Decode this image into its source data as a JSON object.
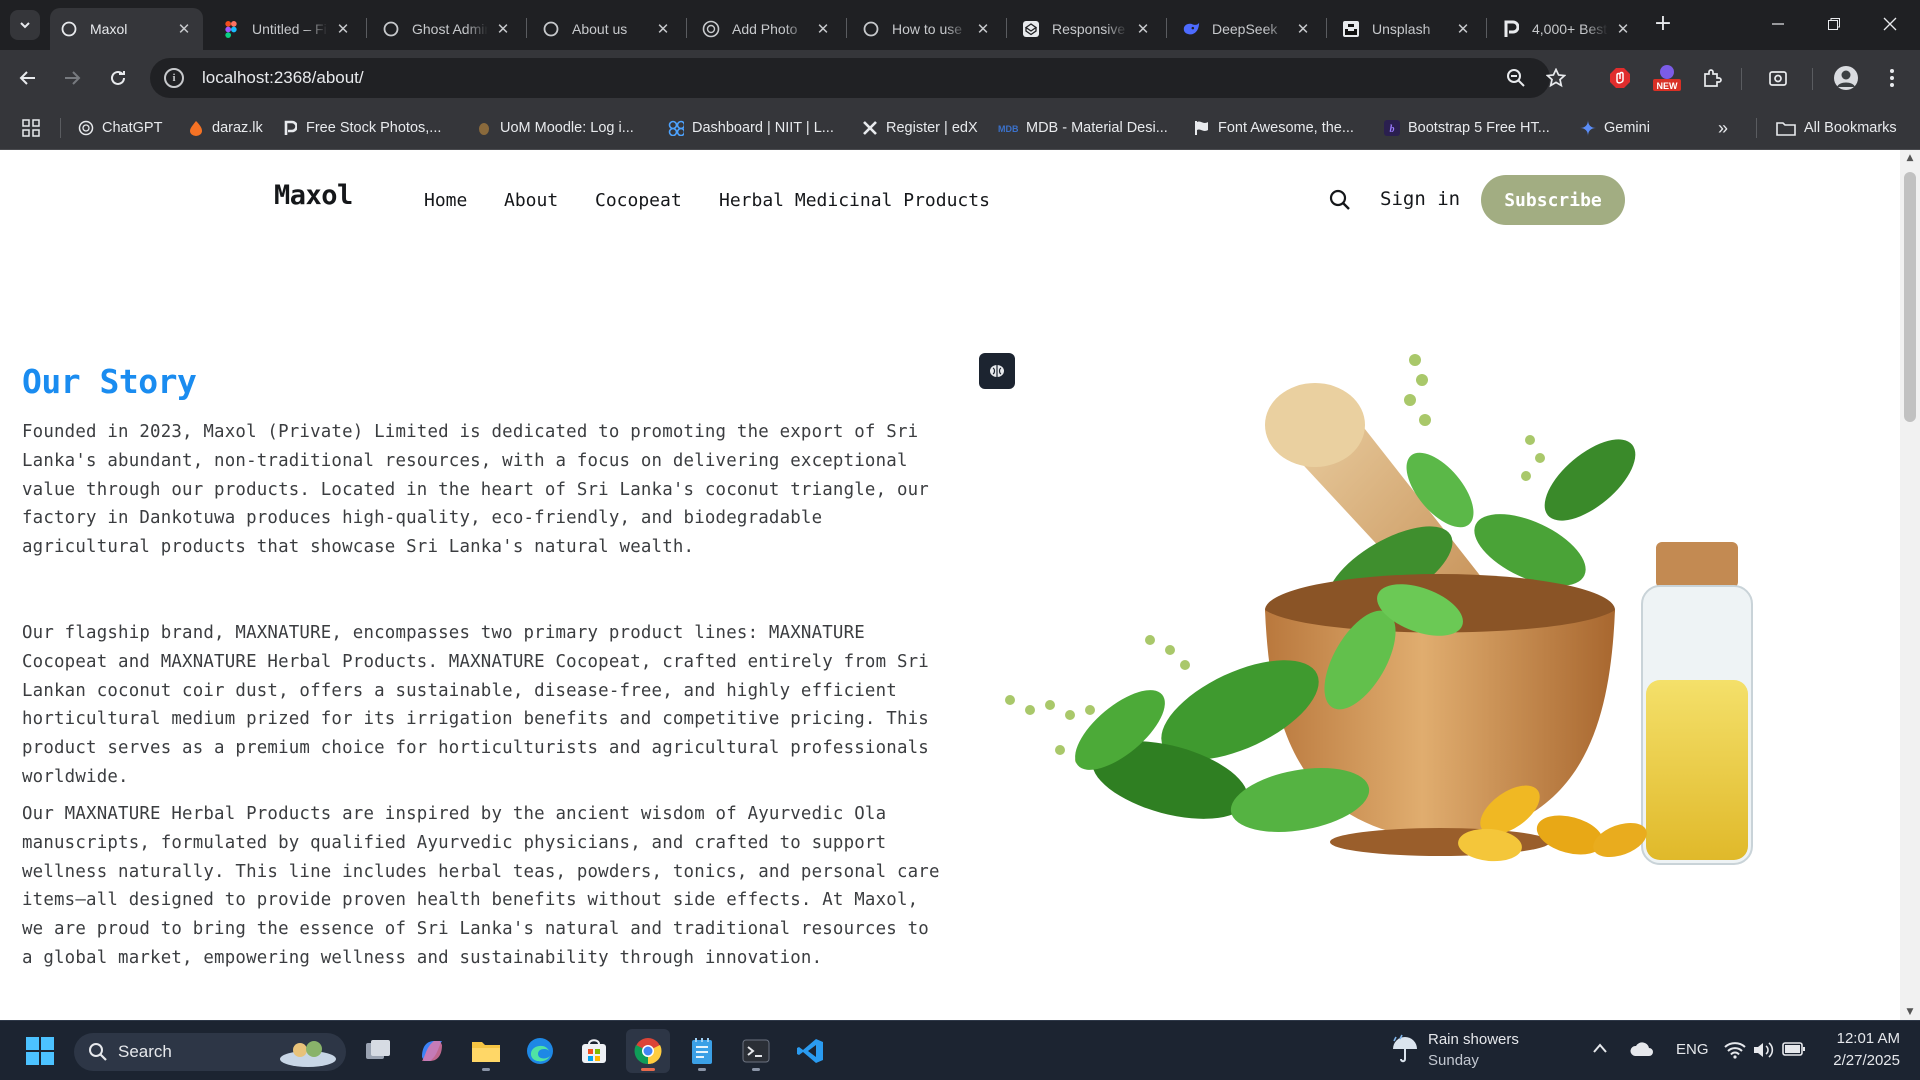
{
  "browser": {
    "tabs": [
      {
        "title": "Maxol",
        "icon": "globe-icon",
        "active": true
      },
      {
        "title": "Untitled – Figma",
        "icon": "figma-icon",
        "active": false
      },
      {
        "title": "Ghost Admin",
        "icon": "globe-icon",
        "active": false
      },
      {
        "title": "About us",
        "icon": "globe-icon",
        "active": false
      },
      {
        "title": "Add Photo",
        "icon": "chatgpt-icon",
        "active": false
      },
      {
        "title": "How to use",
        "icon": "globe-icon",
        "active": false
      },
      {
        "title": "Responsive",
        "icon": "codepen-icon",
        "active": false
      },
      {
        "title": "DeepSeek",
        "icon": "deepseek-icon",
        "active": false
      },
      {
        "title": "Unsplash",
        "icon": "unsplash-icon",
        "active": false
      },
      {
        "title": "4,000+ Best",
        "icon": "pexels-icon",
        "active": false
      }
    ],
    "url": "localhost:2368/about/",
    "bookmarks": [
      {
        "label": "ChatGPT",
        "icon": "chatgpt-icon"
      },
      {
        "label": "daraz.lk",
        "icon": "daraz-icon"
      },
      {
        "label": "Free Stock Photos,...",
        "icon": "pexels-icon"
      },
      {
        "label": "UoM Moodle: Log i...",
        "icon": "moodle-icon"
      },
      {
        "label": "Dashboard | NIIT | L...",
        "icon": "niit-icon"
      },
      {
        "label": "Register | edX",
        "icon": "edx-icon"
      },
      {
        "label": "MDB - Material Desi...",
        "icon": "mdb-icon"
      },
      {
        "label": "Font Awesome, the...",
        "icon": "fontawesome-icon"
      },
      {
        "label": "Bootstrap 5 Free HT...",
        "icon": "bootstrap-icon"
      },
      {
        "label": "Gemini",
        "icon": "gemini-icon"
      }
    ],
    "all_bookmarks": "All Bookmarks",
    "new_badge": "NEW"
  },
  "site": {
    "logo": "Maxol",
    "nav": [
      "Home",
      "About",
      "Cocopeat",
      "Herbal Medicinal Products"
    ],
    "signin": "Sign in",
    "subscribe": "Subscribe"
  },
  "story": {
    "title": "Our Story",
    "paragraphs": [
      "Founded in 2023, Maxol (Private) Limited is dedicated to promoting the export of Sri Lanka's abundant, non-traditional resources, with a focus on delivering exceptional value through our products. Located in the heart of Sri Lanka's coconut triangle, our factory in Dankotuwa produces high-quality, eco-friendly, and biodegradable agricultural products that showcase Sri Lanka's natural wealth.",
      "Our flagship brand, MAXNATURE, encompasses two primary product lines: MAXNATURE Cocopeat and MAXNATURE Herbal Products. MAXNATURE Cocopeat, crafted entirely from Sri Lankan coconut coir dust, offers a sustainable, disease-free, and highly efficient horticultural medium prized for its irrigation benefits and competitive pricing. This product serves as a premium choice for horticulturists and agricultural professionals worldwide.",
      "Our MAXNATURE Herbal Products are inspired by the ancient wisdom of Ayurvedic Ola manuscripts, formulated by qualified Ayurvedic physicians, and crafted to support wellness naturally. This line includes herbal teas, powders, tonics, and personal care items—all designed to provide proven health benefits without side effects. At Maxol, we are proud to bring the essence of Sri Lanka's natural and traditional resources to a global market, empowering wellness and sustainability through innovation."
    ]
  },
  "taskbar": {
    "search_label": "Search",
    "weather_title": "Rain showers",
    "weather_sub": "Sunday",
    "language": "ENG",
    "time": "12:01 AM",
    "date": "2/27/2025"
  },
  "colors": {
    "accent_blue": "#1a8cf0",
    "subscribe_green": "#a2ad82",
    "chrome_dark": "#35363a",
    "taskbar": "#1c2431"
  }
}
